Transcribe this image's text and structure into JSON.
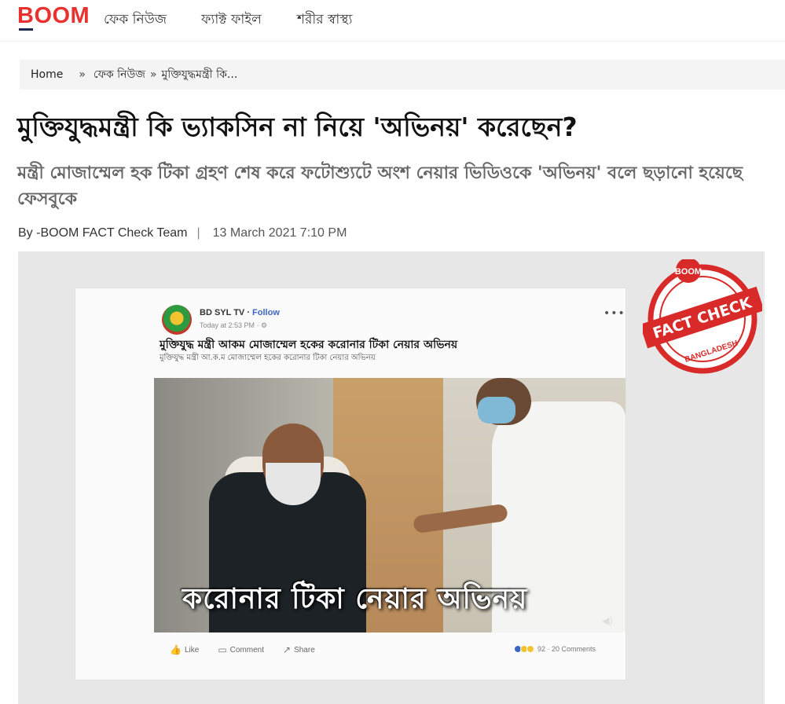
{
  "nav": {
    "logo": "BOOM",
    "links": [
      "ফেক নিউজ",
      "ফ্যাক্ট ফাইল",
      "শরীর স্বাস্থ্য"
    ]
  },
  "breadcrumb": {
    "home": "Home",
    "sep": "»",
    "section": "ফেক নিউজ",
    "current": "মুক্তিযুদ্ধমন্ত্রী কি..."
  },
  "article": {
    "title": "মুক্তিযুদ্ধমন্ত্রী কি ভ্যাকসিন না নিয়ে 'অভিনয়' করেছেন?",
    "subtitle": "মন্ত্রী মোজাম্মেল হক টিকা গ্রহণ শেষ করে ফটোশ্যুটে অংশ নেয়ার ভিডিওকে 'অভিনয়' বলে ছড়ানো হয়েছে ফেসবুকে",
    "byline_prefix": "By - ",
    "author": "BOOM FACT Check Team",
    "pipe": "|",
    "date": "13 March 2021 7:10 PM"
  },
  "fb_post": {
    "page_name": "BD SYL TV",
    "follow_sep": " · ",
    "follow": "Follow",
    "time": "Today at 2:53 PM · ⚙",
    "more": "•••",
    "title": "মুক্তিযুদ্ধ মন্ত্রী আকম মোজাম্মেল হকের করোনার টিকা নেয়ার অভিনয়",
    "caption": "মুক্তিযুদ্ধ মন্ত্রী আ.ক.ম মোজাম্মেল হকের করোনার টিকা নেয়ার অভিনয়",
    "overlay_text": "করোনার টিকা  নেয়ার অভিনয়",
    "speaker": "◀)",
    "actions": {
      "like": "Like",
      "comment": "Comment",
      "share": "Share"
    },
    "reactions": "92 · 20 Comments"
  },
  "stamp": {
    "top": "BOOM",
    "middle": "FACT CHECK",
    "bottom": "BANGLADESH"
  },
  "colors": {
    "brand": "#e8322f",
    "stamp": "#d92a2a"
  }
}
